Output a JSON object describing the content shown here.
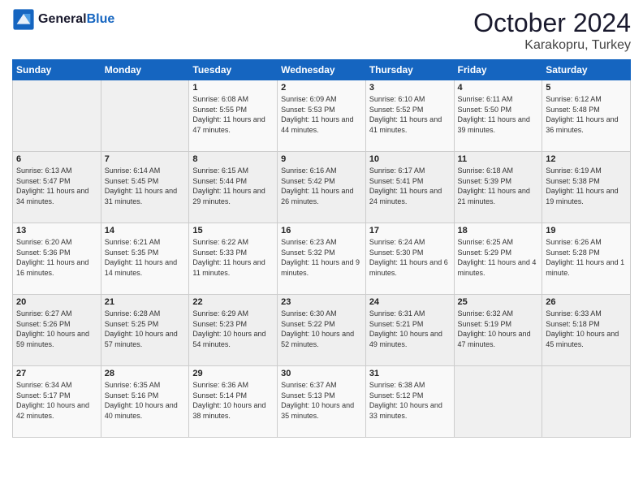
{
  "header": {
    "logo_general": "General",
    "logo_blue": "Blue",
    "month_title": "October 2024",
    "location": "Karakopru, Turkey"
  },
  "weekdays": [
    "Sunday",
    "Monday",
    "Tuesday",
    "Wednesday",
    "Thursday",
    "Friday",
    "Saturday"
  ],
  "weeks": [
    [
      {
        "day": "",
        "sunrise": "",
        "sunset": "",
        "daylight": ""
      },
      {
        "day": "",
        "sunrise": "",
        "sunset": "",
        "daylight": ""
      },
      {
        "day": "1",
        "sunrise": "Sunrise: 6:08 AM",
        "sunset": "Sunset: 5:55 PM",
        "daylight": "Daylight: 11 hours and 47 minutes."
      },
      {
        "day": "2",
        "sunrise": "Sunrise: 6:09 AM",
        "sunset": "Sunset: 5:53 PM",
        "daylight": "Daylight: 11 hours and 44 minutes."
      },
      {
        "day": "3",
        "sunrise": "Sunrise: 6:10 AM",
        "sunset": "Sunset: 5:52 PM",
        "daylight": "Daylight: 11 hours and 41 minutes."
      },
      {
        "day": "4",
        "sunrise": "Sunrise: 6:11 AM",
        "sunset": "Sunset: 5:50 PM",
        "daylight": "Daylight: 11 hours and 39 minutes."
      },
      {
        "day": "5",
        "sunrise": "Sunrise: 6:12 AM",
        "sunset": "Sunset: 5:48 PM",
        "daylight": "Daylight: 11 hours and 36 minutes."
      }
    ],
    [
      {
        "day": "6",
        "sunrise": "Sunrise: 6:13 AM",
        "sunset": "Sunset: 5:47 PM",
        "daylight": "Daylight: 11 hours and 34 minutes."
      },
      {
        "day": "7",
        "sunrise": "Sunrise: 6:14 AM",
        "sunset": "Sunset: 5:45 PM",
        "daylight": "Daylight: 11 hours and 31 minutes."
      },
      {
        "day": "8",
        "sunrise": "Sunrise: 6:15 AM",
        "sunset": "Sunset: 5:44 PM",
        "daylight": "Daylight: 11 hours and 29 minutes."
      },
      {
        "day": "9",
        "sunrise": "Sunrise: 6:16 AM",
        "sunset": "Sunset: 5:42 PM",
        "daylight": "Daylight: 11 hours and 26 minutes."
      },
      {
        "day": "10",
        "sunrise": "Sunrise: 6:17 AM",
        "sunset": "Sunset: 5:41 PM",
        "daylight": "Daylight: 11 hours and 24 minutes."
      },
      {
        "day": "11",
        "sunrise": "Sunrise: 6:18 AM",
        "sunset": "Sunset: 5:39 PM",
        "daylight": "Daylight: 11 hours and 21 minutes."
      },
      {
        "day": "12",
        "sunrise": "Sunrise: 6:19 AM",
        "sunset": "Sunset: 5:38 PM",
        "daylight": "Daylight: 11 hours and 19 minutes."
      }
    ],
    [
      {
        "day": "13",
        "sunrise": "Sunrise: 6:20 AM",
        "sunset": "Sunset: 5:36 PM",
        "daylight": "Daylight: 11 hours and 16 minutes."
      },
      {
        "day": "14",
        "sunrise": "Sunrise: 6:21 AM",
        "sunset": "Sunset: 5:35 PM",
        "daylight": "Daylight: 11 hours and 14 minutes."
      },
      {
        "day": "15",
        "sunrise": "Sunrise: 6:22 AM",
        "sunset": "Sunset: 5:33 PM",
        "daylight": "Daylight: 11 hours and 11 minutes."
      },
      {
        "day": "16",
        "sunrise": "Sunrise: 6:23 AM",
        "sunset": "Sunset: 5:32 PM",
        "daylight": "Daylight: 11 hours and 9 minutes."
      },
      {
        "day": "17",
        "sunrise": "Sunrise: 6:24 AM",
        "sunset": "Sunset: 5:30 PM",
        "daylight": "Daylight: 11 hours and 6 minutes."
      },
      {
        "day": "18",
        "sunrise": "Sunrise: 6:25 AM",
        "sunset": "Sunset: 5:29 PM",
        "daylight": "Daylight: 11 hours and 4 minutes."
      },
      {
        "day": "19",
        "sunrise": "Sunrise: 6:26 AM",
        "sunset": "Sunset: 5:28 PM",
        "daylight": "Daylight: 11 hours and 1 minute."
      }
    ],
    [
      {
        "day": "20",
        "sunrise": "Sunrise: 6:27 AM",
        "sunset": "Sunset: 5:26 PM",
        "daylight": "Daylight: 10 hours and 59 minutes."
      },
      {
        "day": "21",
        "sunrise": "Sunrise: 6:28 AM",
        "sunset": "Sunset: 5:25 PM",
        "daylight": "Daylight: 10 hours and 57 minutes."
      },
      {
        "day": "22",
        "sunrise": "Sunrise: 6:29 AM",
        "sunset": "Sunset: 5:23 PM",
        "daylight": "Daylight: 10 hours and 54 minutes."
      },
      {
        "day": "23",
        "sunrise": "Sunrise: 6:30 AM",
        "sunset": "Sunset: 5:22 PM",
        "daylight": "Daylight: 10 hours and 52 minutes."
      },
      {
        "day": "24",
        "sunrise": "Sunrise: 6:31 AM",
        "sunset": "Sunset: 5:21 PM",
        "daylight": "Daylight: 10 hours and 49 minutes."
      },
      {
        "day": "25",
        "sunrise": "Sunrise: 6:32 AM",
        "sunset": "Sunset: 5:19 PM",
        "daylight": "Daylight: 10 hours and 47 minutes."
      },
      {
        "day": "26",
        "sunrise": "Sunrise: 6:33 AM",
        "sunset": "Sunset: 5:18 PM",
        "daylight": "Daylight: 10 hours and 45 minutes."
      }
    ],
    [
      {
        "day": "27",
        "sunrise": "Sunrise: 6:34 AM",
        "sunset": "Sunset: 5:17 PM",
        "daylight": "Daylight: 10 hours and 42 minutes."
      },
      {
        "day": "28",
        "sunrise": "Sunrise: 6:35 AM",
        "sunset": "Sunset: 5:16 PM",
        "daylight": "Daylight: 10 hours and 40 minutes."
      },
      {
        "day": "29",
        "sunrise": "Sunrise: 6:36 AM",
        "sunset": "Sunset: 5:14 PM",
        "daylight": "Daylight: 10 hours and 38 minutes."
      },
      {
        "day": "30",
        "sunrise": "Sunrise: 6:37 AM",
        "sunset": "Sunset: 5:13 PM",
        "daylight": "Daylight: 10 hours and 35 minutes."
      },
      {
        "day": "31",
        "sunrise": "Sunrise: 6:38 AM",
        "sunset": "Sunset: 5:12 PM",
        "daylight": "Daylight: 10 hours and 33 minutes."
      },
      {
        "day": "",
        "sunrise": "",
        "sunset": "",
        "daylight": ""
      },
      {
        "day": "",
        "sunrise": "",
        "sunset": "",
        "daylight": ""
      }
    ]
  ]
}
